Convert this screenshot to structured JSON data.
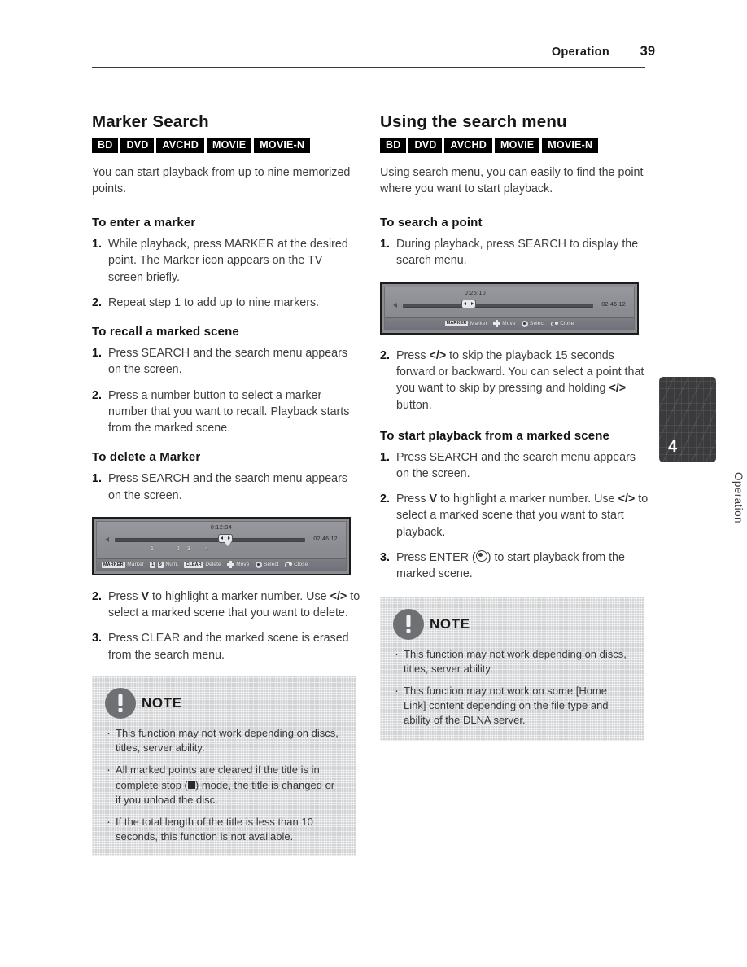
{
  "header": {
    "section": "Operation",
    "page_number": "39"
  },
  "side_tab": {
    "number": "4",
    "label": "Operation"
  },
  "left_column": {
    "title": "Marker Search",
    "badges": [
      "BD",
      "DVD",
      "AVCHD",
      "MOVIE",
      "MOVIE-N"
    ],
    "lead": "You can start playback from up to nine memorized points.",
    "sub1": {
      "title": "To enter a marker",
      "steps": [
        {
          "num": "1.",
          "text": "While playback, press MARKER at the desired point. The Marker icon appears on the TV screen briefly."
        },
        {
          "num": "2.",
          "text": "Repeat step 1 to add up to nine markers."
        }
      ]
    },
    "sub2": {
      "title": "To recall a marked scene",
      "steps": [
        {
          "num": "1.",
          "text": "Press SEARCH and the search menu appears on the screen."
        },
        {
          "num": "2.",
          "text": "Press a number button to select a marker number that you want to recall. Playback starts from the marked scene."
        }
      ]
    },
    "sub3": {
      "title": "To delete a Marker",
      "step1": {
        "num": "1.",
        "text": "Press SEARCH and the search menu appears on the screen."
      },
      "step2": {
        "num": "2.",
        "part1": "Press ",
        "key1": "V",
        "part2": " to highlight a marker number. Use ",
        "key2": "</>",
        "part3": " to select a marked scene that you want to delete."
      },
      "step3": {
        "num": "3.",
        "text": "Press CLEAR and the marked scene is erased from the search menu."
      }
    },
    "osd": {
      "time_current": "0:12:34",
      "time_total": "02:46:12",
      "markers": [
        "1",
        "2",
        "3",
        "4"
      ],
      "hints": [
        {
          "key": "MARKER",
          "label": "Marker"
        },
        {
          "key_pair": [
            "1",
            "9"
          ],
          "label": "Num."
        },
        {
          "key": "CLEAR",
          "label": "Delete"
        },
        {
          "icon": "dpad-icon",
          "label": "Move"
        },
        {
          "icon": "enter-circle-icon",
          "label": "Select"
        },
        {
          "icon": "return-icon",
          "label": "Close"
        }
      ]
    },
    "note": {
      "title": "NOTE",
      "items": [
        {
          "text": "This function may not work depending on discs, titles, server ability."
        },
        {
          "pre": "All marked points are cleared if the title is in complete stop (",
          "post": ") mode, the title is changed or if you unload the disc."
        },
        {
          "text": "If the total length of the title is less than 10 seconds, this function is not available."
        }
      ]
    }
  },
  "right_column": {
    "title": "Using the search menu",
    "badges": [
      "BD",
      "DVD",
      "AVCHD",
      "MOVIE",
      "MOVIE-N"
    ],
    "lead": "Using search menu, you can easily to find the point where you want to start playback.",
    "sub1": {
      "title": "To search a point",
      "step1": {
        "num": "1.",
        "text": "During playback, press SEARCH to display the search menu."
      },
      "step2": {
        "num": "2.",
        "part1": "Press ",
        "key1": "</>",
        "part2": " to skip the playback 15 seconds forward or backward. You can select a point that you want to skip by pressing and holding ",
        "key2": "</>",
        "part3": " button."
      }
    },
    "sub2": {
      "title": "To start playback from a marked scene",
      "step1": {
        "num": "1.",
        "text": "Press SEARCH and the search menu appears on the screen."
      },
      "step2": {
        "num": "2.",
        "part1": "Press ",
        "key1": "V",
        "part2": " to highlight a marker number. Use ",
        "key2": "</>",
        "part3": " to select a marked scene that you want to start playback."
      },
      "step3": {
        "num": "3.",
        "part1": "Press ENTER (",
        "part2": ") to start playback from the marked scene."
      }
    },
    "osd": {
      "time_current": "0:25:10",
      "time_total": "02:46:12",
      "hints": [
        {
          "key": "MARKER",
          "label": "Marker"
        },
        {
          "icon": "dpad-icon",
          "label": "Move"
        },
        {
          "icon": "enter-circle-icon",
          "label": "Select"
        },
        {
          "icon": "return-icon",
          "label": "Close"
        }
      ]
    },
    "note": {
      "title": "NOTE",
      "items": [
        {
          "text": "This function may not work depending on discs, titles, server ability."
        },
        {
          "text": "This function may not work on some [Home Link] content depending on the file type and ability of the DLNA server."
        }
      ]
    }
  }
}
